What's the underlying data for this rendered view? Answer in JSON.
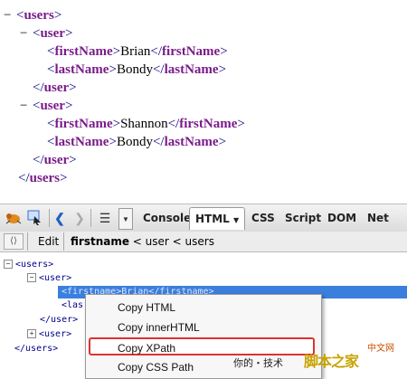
{
  "xml": {
    "root_toggle": "−",
    "user_toggle": "−",
    "users_tag": "users",
    "user_tag": "user",
    "first_tag": "firstName",
    "last_tag": "lastName",
    "user1_first": "Brian",
    "user1_last": "Bondy",
    "user2_first": "Shannon",
    "user2_last": "Bondy"
  },
  "toolbar": {
    "tabs": [
      "Console",
      "HTML",
      "CSS",
      "Script",
      "DOM",
      "Net"
    ],
    "html_dropdown": "▼",
    "icons": [
      "firebug-icon",
      "inspect-icon",
      "back-icon",
      "forward-icon",
      "list-icon",
      "dropdown-icon"
    ]
  },
  "crumbbar": {
    "edit_label": "Edit",
    "path_first": "firstname",
    "path_rest": " < user < users"
  },
  "tree": {
    "row1": "<users>",
    "row2": "<user>",
    "row3": "<firstname>Brian</firstname>",
    "row4": "<las",
    "row5": "</user>",
    "row6": "<user>",
    "row7": "</users>"
  },
  "menu": {
    "items": [
      "Copy HTML",
      "Copy innerHTML",
      "Copy XPath",
      "Copy CSS Path"
    ],
    "highlighted": "Copy XPath"
  },
  "watermark": {
    "cn_text": "你的・技术",
    "logo": "脚本之家",
    "logo_sub": "中文网"
  }
}
